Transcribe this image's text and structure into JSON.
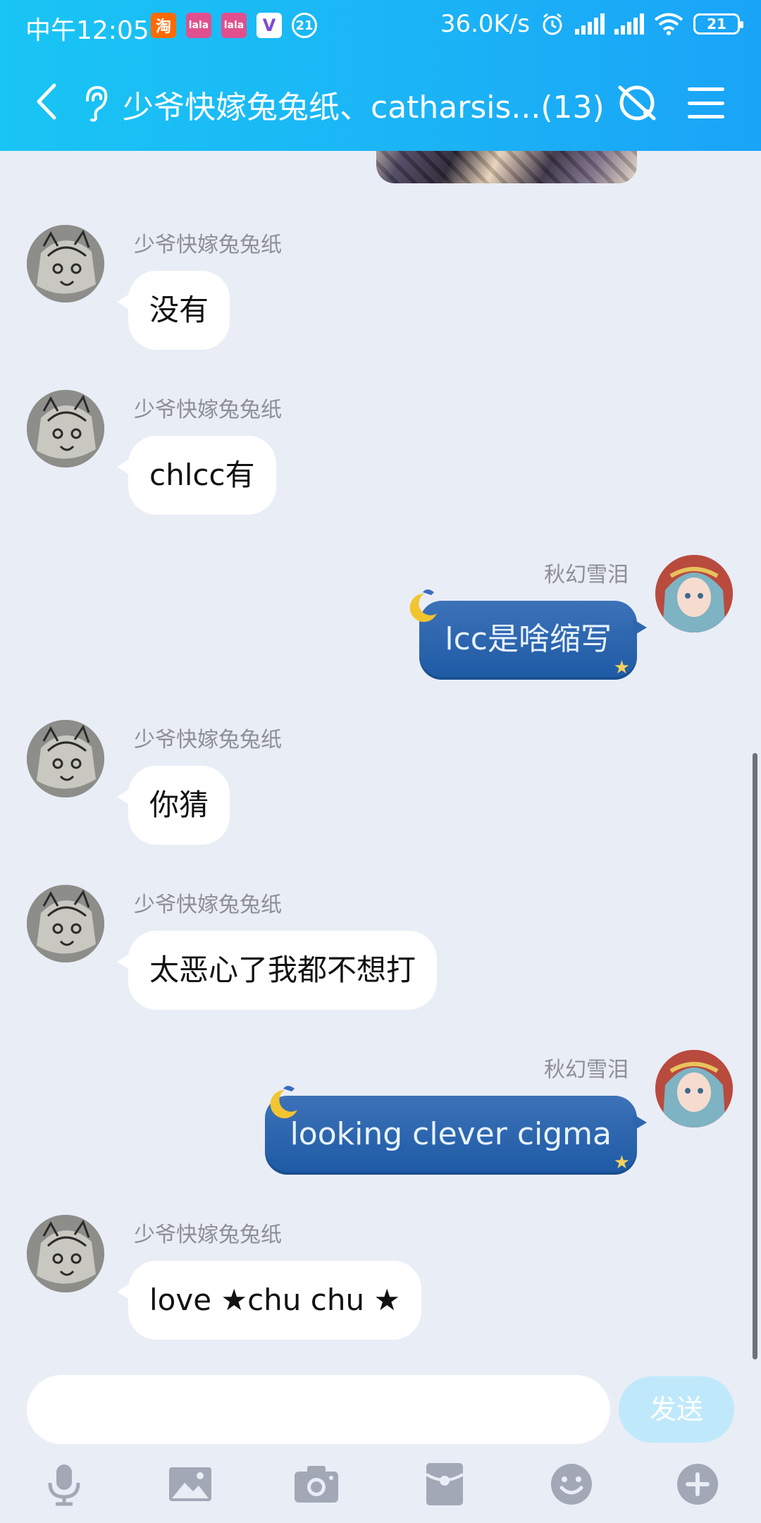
{
  "status_bar": {
    "time": "中午12:05",
    "app_icons": [
      {
        "name": "taobao-icon",
        "text": "淘"
      },
      {
        "name": "lala-icon",
        "text": "lala"
      },
      {
        "name": "lala-icon",
        "text": "lala"
      },
      {
        "name": "v-app-icon",
        "text": "V"
      },
      {
        "name": "notification-count-icon",
        "text": "21"
      }
    ],
    "network_speed": "36.0K/s",
    "battery": "21"
  },
  "header": {
    "title": "少爷快嫁兔兔纸、catharsis...(13)"
  },
  "messages": [
    {
      "side": "left",
      "sender": "少爷快嫁兔兔纸",
      "text": "没有"
    },
    {
      "side": "left",
      "sender": "少爷快嫁兔兔纸",
      "text": "chlcc有"
    },
    {
      "side": "right",
      "sender": "秋幻雪泪",
      "text": "lcc是啥缩写"
    },
    {
      "side": "left",
      "sender": "少爷快嫁兔兔纸",
      "text": "你猜"
    },
    {
      "side": "left",
      "sender": "少爷快嫁兔兔纸",
      "text": "太恶心了我都不想打"
    },
    {
      "side": "right",
      "sender": "秋幻雪泪",
      "text": "looking clever cigma"
    },
    {
      "side": "left",
      "sender": "少爷快嫁兔兔纸",
      "text": "love ★chu chu ★"
    }
  ],
  "input": {
    "value": "",
    "send_label": "发送"
  },
  "colors": {
    "header_start": "#19c5f4",
    "header_end": "#1aa4f7",
    "chat_background": "#e9edf6",
    "right_bubble": "#2a64ad",
    "send_button": "#bfe9fb"
  },
  "toolbar_icons": [
    "microphone-icon",
    "image-icon",
    "camera-icon",
    "red-packet-icon",
    "emoji-icon",
    "plus-icon"
  ]
}
